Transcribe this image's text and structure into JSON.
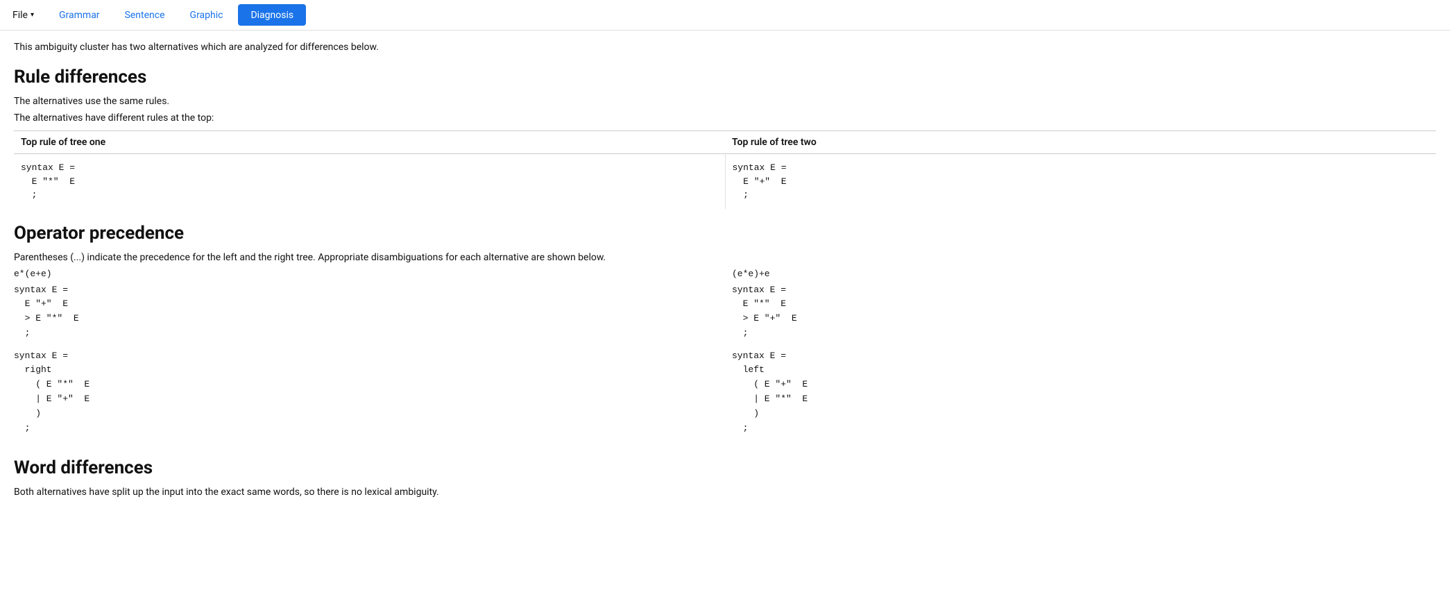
{
  "navbar": {
    "file_label": "File",
    "grammar_label": "Grammar",
    "sentence_label": "Sentence",
    "graphic_label": "Graphic",
    "diagnosis_label": "Diagnosis"
  },
  "content": {
    "intro": "This ambiguity cluster has two alternatives which are analyzed for differences below.",
    "rule_differences": {
      "heading": "Rule differences",
      "line1": "The alternatives use the same rules.",
      "line2": "The alternatives have different rules at the top:",
      "col1_header": "Top rule of tree one",
      "col2_header": "Top rule of tree two",
      "col1_code": "syntax E =\n  E \"*\"  E\n  ;",
      "col2_code": "syntax E =\n  E \"+\"  E\n  ;"
    },
    "operator_precedence": {
      "heading": "Operator precedence",
      "description": "Parentheses (...) indicate the precedence for the left and the right tree. Appropriate disambiguations for each alternative are shown below.",
      "left_label": "e*(e+e)",
      "right_label": "(e*e)+e",
      "left_code1": "syntax E =\n  E \"+\"  E\n  > E \"*\"  E\n  ;",
      "right_code1": "syntax E =\n  E \"*\"  E\n  > E \"+\"  E\n  ;",
      "left_code2": "syntax E =\n  right\n    ( E \"*\"  E\n    | E \"+\"  E\n    )\n  ;",
      "right_code2": "syntax E =\n  left\n    ( E \"+\"  E\n    | E \"*\"  E\n    )\n  ;"
    },
    "word_differences": {
      "heading": "Word differences",
      "description": "Both alternatives have split up the input into the exact same words, so there is no lexical ambiguity."
    }
  }
}
